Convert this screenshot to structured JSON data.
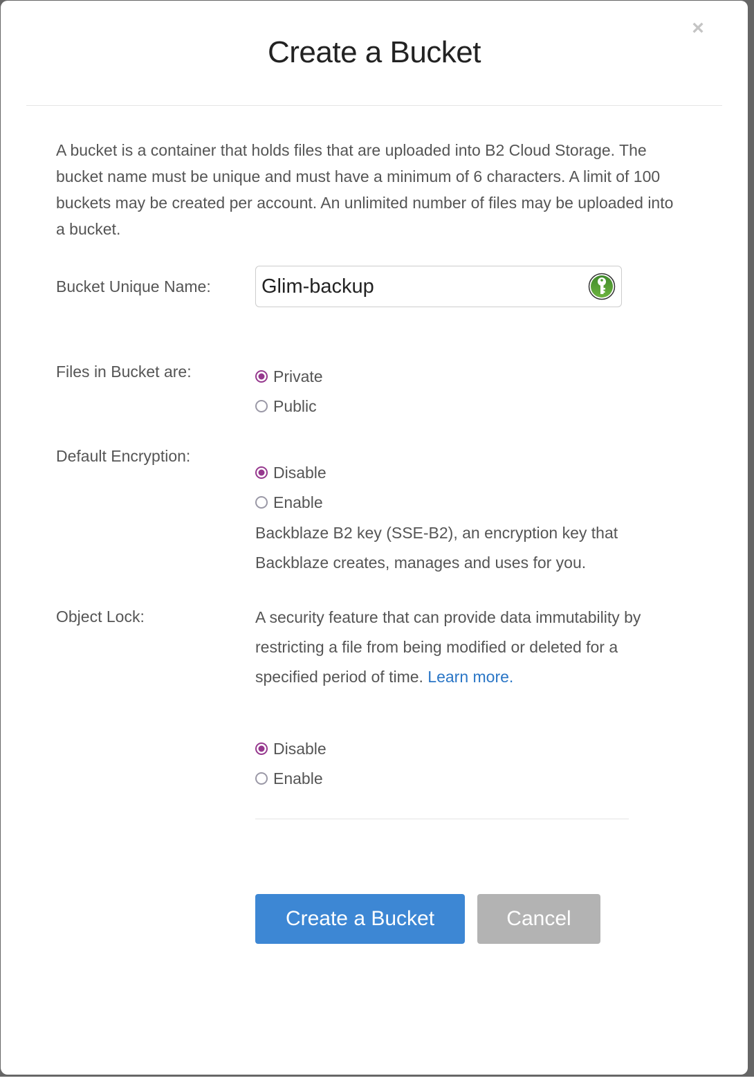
{
  "modal": {
    "title": "Create a Bucket",
    "close_label": "×",
    "intro": "A bucket is a container that holds files that are uploaded into B2 Cloud Storage. The bucket name must be unique and must have a minimum of 6 characters. A limit of 100 buckets may be created per account. An unlimited number of files may be uploaded into a bucket."
  },
  "form": {
    "bucket_name": {
      "label": "Bucket Unique Name:",
      "value": "Glim-backup",
      "icon": "password-manager-key-icon"
    },
    "files_visibility": {
      "label": "Files in Bucket are:",
      "options": [
        {
          "label": "Private",
          "checked": true
        },
        {
          "label": "Public",
          "checked": false
        }
      ]
    },
    "default_encryption": {
      "label": "Default Encryption:",
      "options": [
        {
          "label": "Disable",
          "checked": true
        },
        {
          "label": "Enable",
          "checked": false
        }
      ],
      "description": "Backblaze B2 key (SSE-B2), an encryption key that Backblaze creates, manages and uses for you."
    },
    "object_lock": {
      "label": "Object Lock:",
      "description": "A security feature that can provide data immutability by restricting a file from being modified or deleted for a specified period of time.",
      "link_label": "Learn more.",
      "options": [
        {
          "label": "Disable",
          "checked": true
        },
        {
          "label": "Enable",
          "checked": false
        }
      ]
    }
  },
  "buttons": {
    "create_label": "Create a Bucket",
    "cancel_label": "Cancel"
  },
  "colors": {
    "primary_button": "#3d87d4",
    "cancel_button": "#b3b3b3",
    "radio_checked": "#96388e",
    "link": "#2a76c6"
  }
}
